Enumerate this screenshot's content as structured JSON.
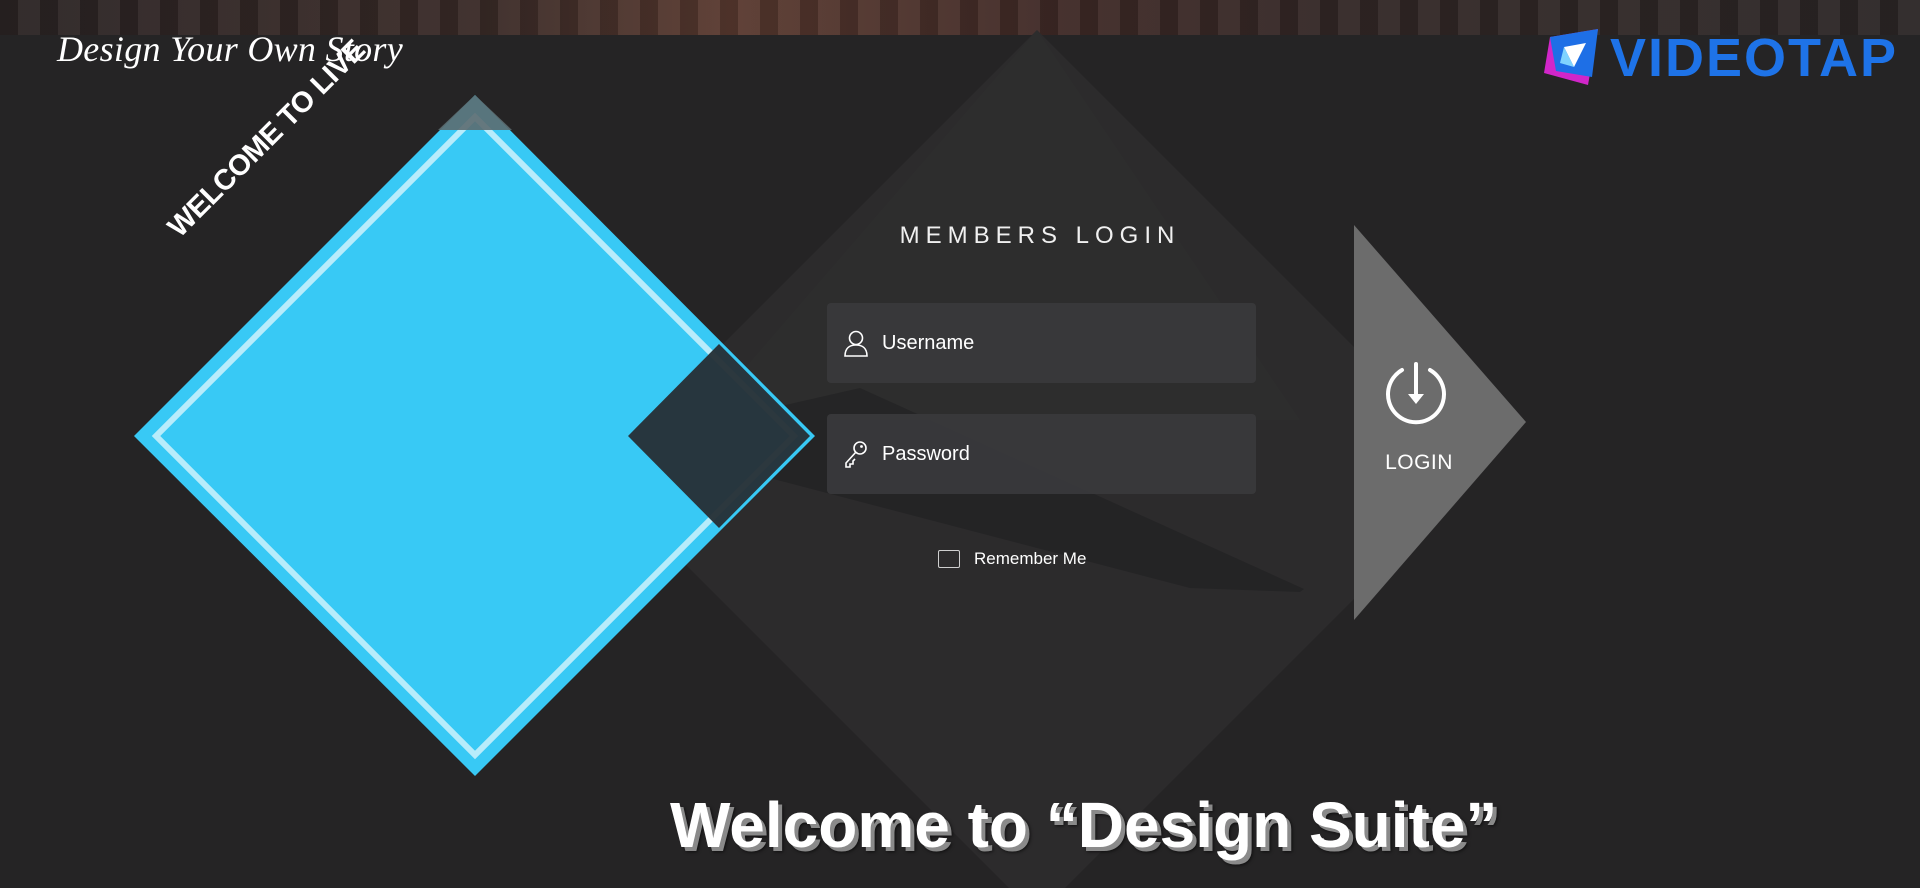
{
  "header": {
    "tagline": "Design Your Own Story",
    "brand_name": "VIDEOTAP"
  },
  "hero": {
    "diamond_text": "WELCOME TO LIVE",
    "welcome_headline": "Welcome to  “Design Suite”"
  },
  "login": {
    "title": "MEMBERS LOGIN",
    "username_placeholder": "Username",
    "password_placeholder": "Password",
    "remember_label": "Remember Me",
    "remember_checked": false,
    "submit_label": "LOGIN"
  },
  "icons": {
    "username": "user-icon",
    "password": "key-icon",
    "submit": "power-icon",
    "brand": "videotap-logo-icon"
  },
  "colors": {
    "background": "#252425",
    "accent_cyan": "#38c9f5",
    "brand_blue": "#1e73e8",
    "brand_magenta": "#d126c9",
    "login_arrow": "#6e6e6e",
    "field_bg": "#3a3a3c"
  }
}
